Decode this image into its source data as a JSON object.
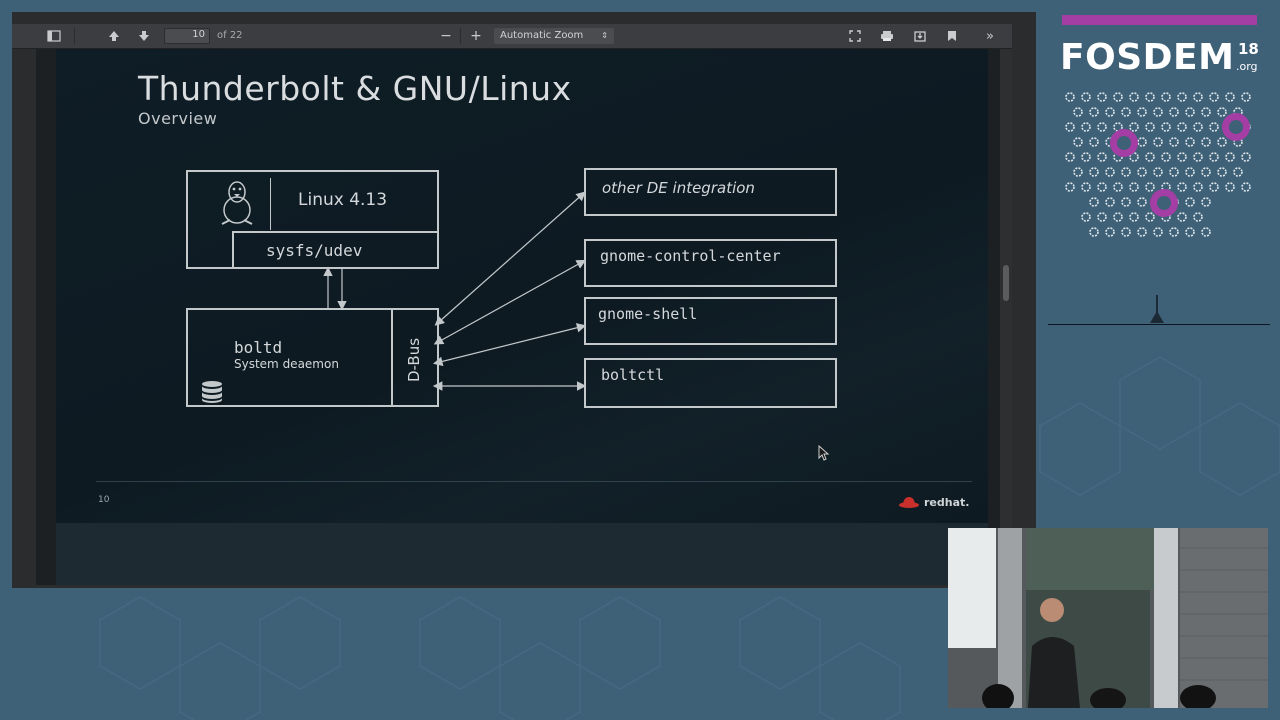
{
  "viewer": {
    "toolbar": {
      "sidebar_icon": "sidebar-toggle-icon",
      "prev_icon": "arrow-up-icon",
      "next_icon": "arrow-down-icon",
      "page_number": "10",
      "page_count": "of 22",
      "zoom_out": "−",
      "zoom_in": "+",
      "zoom_value": "Automatic Zoom",
      "right_icons": [
        "fullscreen-icon",
        "print-icon",
        "download-icon",
        "bookmark-icon",
        "tools-icon"
      ]
    }
  },
  "slide": {
    "title": "Thunderbolt & GNU/Linux",
    "subtitle": "Overview",
    "number": "10",
    "brand": "redhat.",
    "diagram": {
      "kernel": "Linux 4.13",
      "sysfs": "sysfs/udev",
      "daemon": "boltd",
      "daemon_sub": "System deaemon",
      "bus": "D-Bus",
      "clients": [
        "other DE integration",
        "gnome-control-center",
        "gnome-shell",
        "boltctl"
      ]
    }
  },
  "branding": {
    "name": "FOSDEM",
    "year": "18",
    "tld": ".org",
    "accent": "#a43da4"
  }
}
